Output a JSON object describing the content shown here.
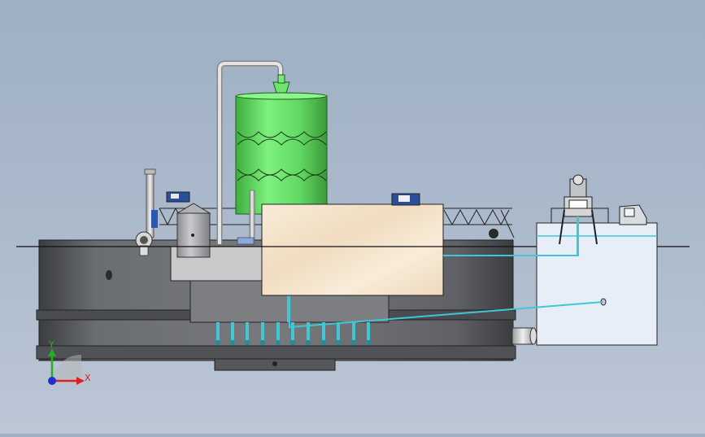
{
  "viewport": {
    "background_top": "#9fb0c4",
    "background_bottom": "#bcc7d6"
  },
  "triad": {
    "x_label": "X",
    "y_label": "Y",
    "x_color": "#e02020",
    "y_color": "#20b020",
    "origin_color": "#2030d0"
  },
  "model": {
    "tower_color": "#66dd66",
    "main_tank_color": "#5a5c60",
    "box_color": "#f4e6cf",
    "side_tank_color": "#e8eef8",
    "pipe_color": "#3fc7d6"
  }
}
